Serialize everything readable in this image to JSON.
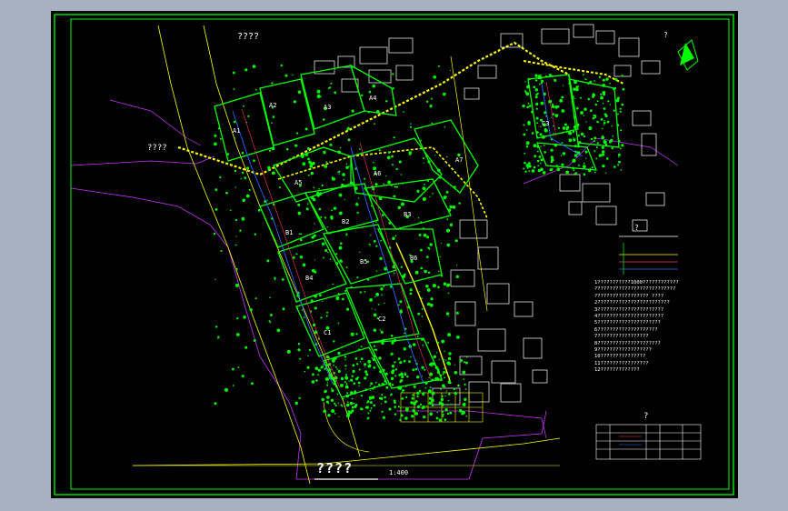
{
  "drawing": {
    "top_label": "????",
    "left_label": "????",
    "bottom_title": "????",
    "scale": "1:400",
    "north_symbol": "?",
    "legend_title": "?",
    "detail_title": "?",
    "plot_labels": [
      "A1",
      "A2",
      "A3",
      "A4",
      "A5",
      "A6",
      "A7",
      "B1",
      "B2",
      "B3",
      "B4",
      "B5",
      "B6",
      "C1",
      "C2",
      "C3"
    ],
    "notes": [
      "1???????????1000????????????",
      "???????????????????????????",
      "?????????????????? ????",
      "2????????????????????????",
      "3??????????????????????",
      "4??????????????????????",
      "5?????????????????????",
      "6????????????????????",
      "7?????????????????",
      "8?????????????????????",
      "9??????????????????",
      "10???????????????",
      "11????????????????",
      "12?????????????"
    ],
    "colors": {
      "background": "#000000",
      "border": "#00ff00",
      "building": "#ffffff",
      "greenery": "#00ff00",
      "road": "#ffff00",
      "boundary": "#cc33ff",
      "pipe": "#3366ff"
    }
  }
}
